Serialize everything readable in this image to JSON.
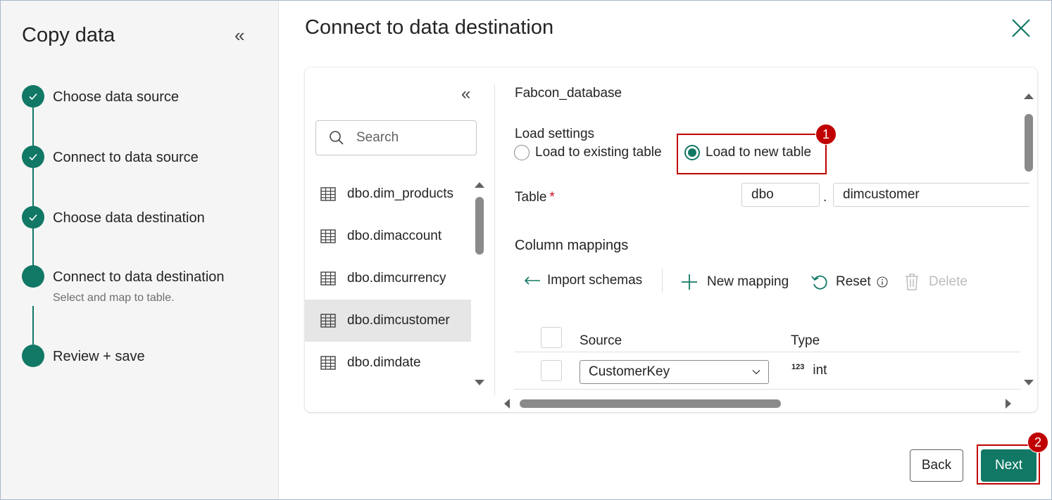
{
  "wizard": {
    "title": "Copy data",
    "steps": [
      {
        "label": "Choose data source",
        "status": "completed"
      },
      {
        "label": "Connect to data source",
        "status": "completed"
      },
      {
        "label": "Choose data destination",
        "status": "completed"
      },
      {
        "label": "Connect to data destination",
        "status": "current",
        "sublabel": "Select and map to table."
      },
      {
        "label": "Review + save",
        "status": "pending"
      }
    ]
  },
  "main": {
    "title": "Connect to data destination"
  },
  "table_list": {
    "search_placeholder": "Search",
    "items": [
      {
        "label": "dbo.dim_products",
        "selected": false
      },
      {
        "label": "dbo.dimaccount",
        "selected": false
      },
      {
        "label": "dbo.dimcurrency",
        "selected": false
      },
      {
        "label": "dbo.dimcustomer",
        "selected": true
      },
      {
        "label": "dbo.dimdate",
        "selected": false
      }
    ]
  },
  "settings": {
    "database_name": "Fabcon_database",
    "load_settings_label": "Load settings",
    "option_existing": "Load to existing table",
    "option_new": "Load to new table",
    "selected_option": "new",
    "table_label": "Table",
    "required_marker": "*",
    "schema_value": "dbo",
    "separator": ".",
    "table_value": "dimcustomer",
    "column_mappings_title": "Column mappings",
    "toolbar": {
      "import_schemas": "Import schemas",
      "new_mapping": "New mapping",
      "reset": "Reset",
      "delete": "Delete"
    },
    "grid": {
      "headers": {
        "source": "Source",
        "type": "Type"
      },
      "rows": [
        {
          "source": "CustomerKey",
          "type_prefix": "123",
          "type": "int"
        }
      ]
    }
  },
  "annotations": {
    "badge_1": "1",
    "badge_2": "2",
    "color": "#c00000"
  },
  "footer": {
    "back_label": "Back",
    "next_label": "Next"
  },
  "colors": {
    "accent": "#117865",
    "annotation": "#c00000"
  }
}
